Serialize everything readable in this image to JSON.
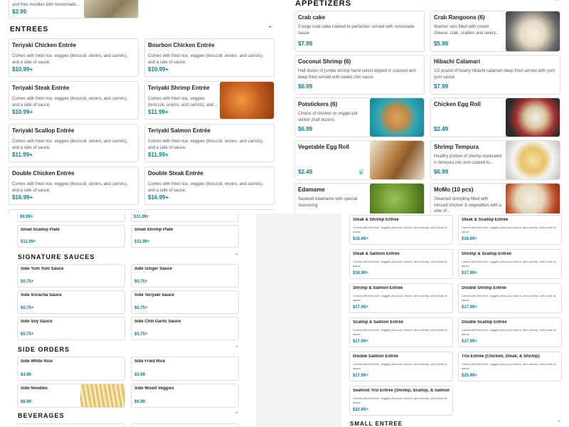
{
  "colors": {
    "price": "#0f7a8a",
    "border": "#dcdcdc"
  },
  "top_left": {
    "partial_desc": "and fries noodles with homemade...",
    "partial_price": "$3.99",
    "entrees": {
      "title": "ENTREES",
      "items": [
        {
          "name": "Teriyaki Chicken Entrée",
          "desc": "Comes with fried rice, veggies (broccoli, onions, and carrots), and a side of sauce.",
          "price": "$10.99+"
        },
        {
          "name": "Bourbon Chicken Entrée",
          "desc": "Comes with fried rice, veggies (broccoli, onions, and carrots), and a side of sauce.",
          "price": "$10.99+"
        },
        {
          "name": "Teriyaki Steak Entrée",
          "desc": "Comes with fried rice, veggies (broccoli, onions, and carrots), and a side of sauce.",
          "price": "$10.99+"
        },
        {
          "name": "Teriyaki Shrimp Entrée",
          "desc": "Comes with fried rice, veggies (broccoli, onions, and carrots), and ...",
          "price": "$11.99+"
        },
        {
          "name": "Teriyaki Scallop Entrée",
          "desc": "Comes with fried rice, veggies (broccoli, onions, and carrots), and a side of sauce.",
          "price": "$11.99+"
        },
        {
          "name": "Teriyaki Salmon Entrée",
          "desc": "Comes with fried rice, veggies (broccoli, onions, and carrots), and a side of sauce.",
          "price": "$11.99+"
        },
        {
          "name": "Double Chicken Entrée",
          "desc": "Comes with fried rice, veggies (broccoli, onions, and carrots), and a side of sauce.",
          "price": "$16.99+"
        },
        {
          "name": "Double Steak Entrée",
          "desc": "Comes with fried rice, veggies (broccoli, onions, and carrots), and a side of sauce.",
          "price": "$16.99+"
        }
      ]
    }
  },
  "top_right": {
    "appetizers": {
      "title": "APPETIZERS",
      "items": [
        {
          "name": "Crab cake",
          "desc": "3 large crab cake cooked to perfection served with remoulade sauce",
          "price": "$7.99"
        },
        {
          "name": "Crab Rangoons (6)",
          "desc": "Wanton skin filled with cream cheese, crab, scallion and celery...",
          "price": "$5.99"
        },
        {
          "name": "Coconut Shrimp (6)",
          "desc": "Half dozen of jumbo shrimp hand select dipped in coconut and deep fried served with sweet chili sauce",
          "price": "$6.99"
        },
        {
          "name": "Hibachi Calamari",
          "desc": "1/2 pound of hearty hibachi calamari deep fried served with yum yum sauce",
          "price": "$7.99"
        },
        {
          "name": "Potstickers (6)",
          "desc": "Choice of chicken or veggie pot sticker (half dozen).",
          "price": "$6.99"
        },
        {
          "name": "Chicken Egg Roll",
          "desc": "",
          "price": "$2.49"
        },
        {
          "name": "Vegetable Egg Roll",
          "desc": "",
          "price": "$2.49"
        },
        {
          "name": "Shrimp Tempura",
          "desc": "Healthy portion of shrimp marinated in tempura mix and cooked to...",
          "price": "$6.99"
        },
        {
          "name": "Edamame",
          "desc": "Sauteed edamame with special seasoning.",
          "price": ""
        },
        {
          "name": "MoMo (10 pcs)",
          "desc": "Steamed dumpling filled with minced chicken & vegetables with a side of...",
          "price": ""
        }
      ]
    }
  },
  "bottom_left": {
    "top_prices": [
      "$9.99+",
      "$11.99+"
    ],
    "plates": [
      {
        "name": "Small Scallop Plate",
        "price": "$11.99+"
      },
      {
        "name": "Small Shrimp Plate",
        "price": "$11.99+"
      }
    ],
    "sauces": {
      "title": "SIGNATURE SAUCES",
      "items": [
        {
          "name": "Side Yum Yum Sauce",
          "price": "$0.75+"
        },
        {
          "name": "Side Ginger Sauce",
          "price": "$0.75+"
        },
        {
          "name": "Side Sriracha Sauce",
          "price": "$0.75+"
        },
        {
          "name": "Side Teriyaki Sauce",
          "price": "$0.75+"
        },
        {
          "name": "Side Soy Sauce",
          "price": "$0.75+"
        },
        {
          "name": "Side Chili Garlic Sauce",
          "price": "$0.75+"
        }
      ]
    },
    "sides": {
      "title": "SIDE ORDERS",
      "items": [
        {
          "name": "Side White Rice",
          "price": "$4.99"
        },
        {
          "name": "Side Fried Rice",
          "price": "$5.99"
        },
        {
          "name": "Side Noodles",
          "price": "$6.99"
        },
        {
          "name": "Side Mixed Veggies",
          "price": "$6.99"
        }
      ]
    },
    "beverages_title": "BEVERAGES"
  },
  "bottom_right": {
    "items": [
      {
        "name": "Steak & Shrimp Entrée",
        "desc": "Comes with fried rice, veggies (broccoli, onions, and carrots), and a side of sauce.",
        "price": "$16.99+"
      },
      {
        "name": "Steak & Scallop Entrée",
        "desc": "Comes with fried rice, veggies (broccoli, onions, and carrots), and a side of sauce.",
        "price": "$16.99+"
      },
      {
        "name": "Steak & Salmon Entrée",
        "desc": "Comes with fried rice, veggies (broccoli, onions, and carrots), and a side of sauce.",
        "price": "$16.99+"
      },
      {
        "name": "Shrimp & Scallop Entrée",
        "desc": "Comes with fried rice, veggies (broccoli, onions, and carrots), and a side of sauce.",
        "price": "$17.99+"
      },
      {
        "name": "Shrimp & Salmon Entrée",
        "desc": "Comes with fried rice, veggies (broccoli, onions, and carrots), and a side of sauce.",
        "price": "$17.99+"
      },
      {
        "name": "Double Shrimp Entrée",
        "desc": "Comes with fried rice, veggies (broccoli, onions, and carrots), and a side of sauce.",
        "price": "$17.99+"
      },
      {
        "name": "Scallop & Salmon Entrée",
        "desc": "Comes with fried rice, veggies (broccoli, onions, and carrots), and a side of sauce.",
        "price": "$17.99+"
      },
      {
        "name": "Double Scallop Entrée",
        "desc": "Comes with fried rice, veggies (broccoli, onions, and carrots), and a side of sauce.",
        "price": "$17.99+"
      },
      {
        "name": "Double Salmon Entrée",
        "desc": "Comes with fried rice, veggies (broccoli, onions, and carrots), and a side of sauce.",
        "price": "$17.99+"
      },
      {
        "name": "Trio Entrée (Chicken, Steak, & Shrimp)",
        "desc": "Comes with fried rice, veggies (broccoli, onions, and carrots), and a side of sauce.",
        "price": "$20.99+"
      },
      {
        "name": "Seafood Trio Entrée (Shrimp, Scallop, & Salmon)",
        "desc": "Comes with fried rice, veggies (broccoli, onions, and carrots), and a side of sauce.",
        "price": "$22.99+"
      }
    ],
    "small_entree_title": "SMALL ENTREE"
  }
}
